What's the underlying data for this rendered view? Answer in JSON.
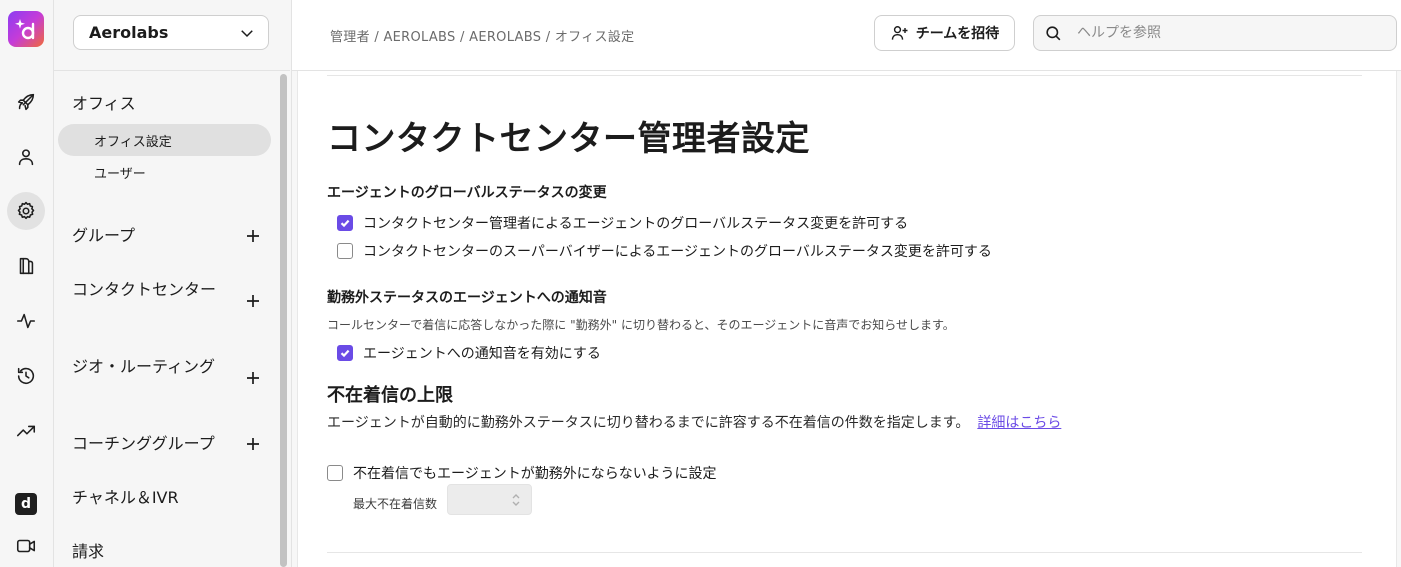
{
  "workspace": {
    "name": "Aerolabs"
  },
  "breadcrumb": "管理者 / AEROLABS / AEROLABS / オフィス設定",
  "header": {
    "invite_label": "チームを招待",
    "search_placeholder": "ヘルプを参照"
  },
  "sidebar": {
    "office": {
      "label": "オフィス",
      "items": [
        "オフィス設定",
        "ユーザー"
      ]
    },
    "groups": [
      {
        "label": "グループ",
        "addable": true
      },
      {
        "label": "コンタクトセンター",
        "addable": true
      },
      {
        "label": "ジオ・ルーティング",
        "addable": true
      },
      {
        "label": "コーチンググループ",
        "addable": true
      },
      {
        "label": "チャネル＆IVR",
        "addable": false
      },
      {
        "label": "請求",
        "addable": false
      }
    ]
  },
  "rail": {
    "icons": [
      "rocket-icon",
      "user-icon",
      "gear-icon",
      "contacts-icon",
      "activity-icon",
      "history-icon",
      "trending-icon",
      "dialpad-brand-icon",
      "video-icon"
    ],
    "active": "gear-icon"
  },
  "content": {
    "title": "コンタクトセンター管理者設定",
    "global_status": {
      "heading": "エージェントのグローバルステータスの変更",
      "options": [
        {
          "label": "コンタクトセンター管理者によるエージェントのグローバルステータス変更を許可する",
          "checked": true
        },
        {
          "label": "コンタクトセンターのスーパーバイザーによるエージェントのグローバルステータス変更を許可する",
          "checked": false
        }
      ]
    },
    "offduty_sound": {
      "heading": "勤務外ステータスのエージェントへの通知音",
      "helper": "コールセンターで着信に応答しなかった際に \"勤務外\" に切り替わると、そのエージェントに音声でお知らせします。",
      "option": {
        "label": "エージェントへの通知音を有効にする",
        "checked": true
      }
    },
    "missed_limit": {
      "heading": "不在着信の上限",
      "description": "エージェントが自動的に勤務外ステータスに切り替わるまでに許容する不在着信の件数を指定します。",
      "link": "詳細はこちら",
      "option": {
        "label": "不在着信でもエージェントが勤務外にならないように設定",
        "checked": false
      },
      "field_label": "最大不在着信数",
      "field_value": ""
    }
  },
  "colors": {
    "accent": "#6a4be6",
    "link": "#6b4be6"
  }
}
